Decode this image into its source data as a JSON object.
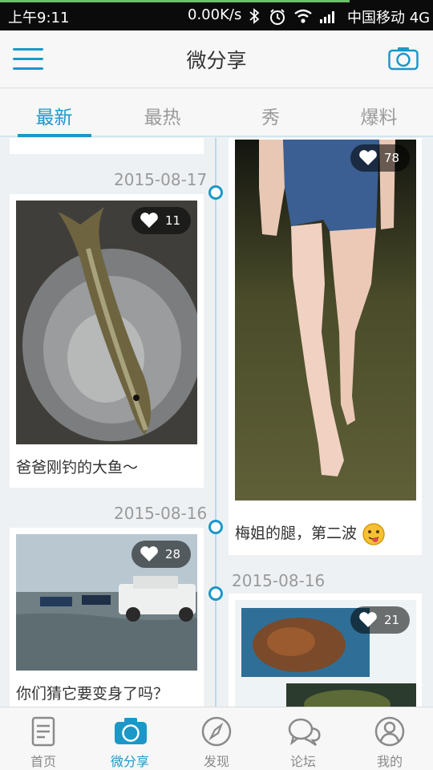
{
  "status_bar": {
    "time": "上午9:11",
    "network_speed": "0.00K/s",
    "carrier": "中国移动 4G",
    "icons": [
      "bluetooth-icon",
      "alarm-icon",
      "wifi-icon",
      "signal-icon"
    ]
  },
  "app_bar": {
    "title": "微分享",
    "left_icon": "menu-icon",
    "right_icon": "camera-icon"
  },
  "tabs": [
    {
      "label": "最新",
      "active": true
    },
    {
      "label": "最热",
      "active": false
    },
    {
      "label": "秀",
      "active": false
    },
    {
      "label": "爆料",
      "active": false
    }
  ],
  "feed": {
    "left": [
      {
        "date": "2015-08-17",
        "likes": "11",
        "caption": "爸爸刚钓的大鱼～"
      },
      {
        "date": "2015-08-16",
        "likes": "28",
        "caption": "你们猜它要变身了吗？"
      }
    ],
    "right": [
      {
        "likes": "78",
        "caption": "梅姐的腿，第二波"
      },
      {
        "date": "2015-08-16",
        "likes": "21"
      }
    ]
  },
  "bottom_nav": [
    {
      "label": "首页",
      "icon": "document-icon",
      "active": false
    },
    {
      "label": "微分享",
      "icon": "camera-icon",
      "active": true
    },
    {
      "label": "发现",
      "icon": "compass-icon",
      "active": false
    },
    {
      "label": "论坛",
      "icon": "chat-bubbles-icon",
      "active": false
    },
    {
      "label": "我的",
      "icon": "user-icon",
      "active": false
    }
  ],
  "colors": {
    "accent": "#1b98c8",
    "status_bar": "#0b0b0b",
    "background": "#eef1f4"
  }
}
